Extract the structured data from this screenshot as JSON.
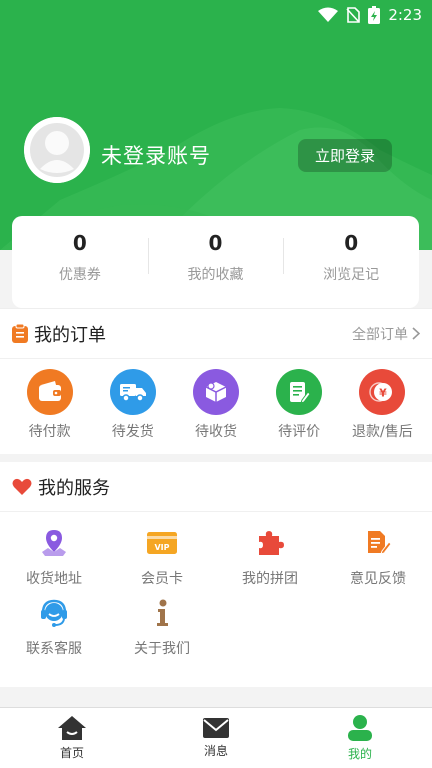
{
  "status_bar": {
    "time": "2:23"
  },
  "profile": {
    "name": "未登录账号",
    "login_button": "立即登录"
  },
  "stats": [
    {
      "value": "0",
      "label": "优惠券"
    },
    {
      "value": "0",
      "label": "我的收藏"
    },
    {
      "value": "0",
      "label": "浏览足记"
    }
  ],
  "orders": {
    "title": "我的订单",
    "more": "全部订单",
    "items": [
      {
        "label": "待付款",
        "icon": "wallet-icon",
        "color": "#f07a23"
      },
      {
        "label": "待发货",
        "icon": "truck-icon",
        "color": "#2f9be8"
      },
      {
        "label": "待收货",
        "icon": "box-icon",
        "color": "#8a5ae0"
      },
      {
        "label": "待评价",
        "icon": "review-icon",
        "color": "#2bb24c"
      },
      {
        "label": "退款/售后",
        "icon": "refund-icon",
        "color": "#e84a3a"
      }
    ]
  },
  "services": {
    "title": "我的服务",
    "items": [
      {
        "label": "收货地址",
        "icon": "map-pin-icon",
        "color": "#8a5ae0"
      },
      {
        "label": "会员卡",
        "icon": "vip-card-icon",
        "color": "#f5a623",
        "badge": "VIP"
      },
      {
        "label": "我的拼团",
        "icon": "puzzle-icon",
        "color": "#e84a3a"
      },
      {
        "label": "意见反馈",
        "icon": "feedback-icon",
        "color": "#f07a23"
      },
      {
        "label": "联系客服",
        "icon": "headset-icon",
        "color": "#2f9be8"
      },
      {
        "label": "关于我们",
        "icon": "info-icon",
        "color": "#a0744a"
      }
    ]
  },
  "tabbar": [
    {
      "label": "首页",
      "icon": "home-icon",
      "active": false
    },
    {
      "label": "消息",
      "icon": "mail-icon",
      "active": false
    },
    {
      "label": "我的",
      "icon": "user-icon",
      "active": true
    }
  ],
  "colors": {
    "brand_green": "#2bb24c"
  }
}
